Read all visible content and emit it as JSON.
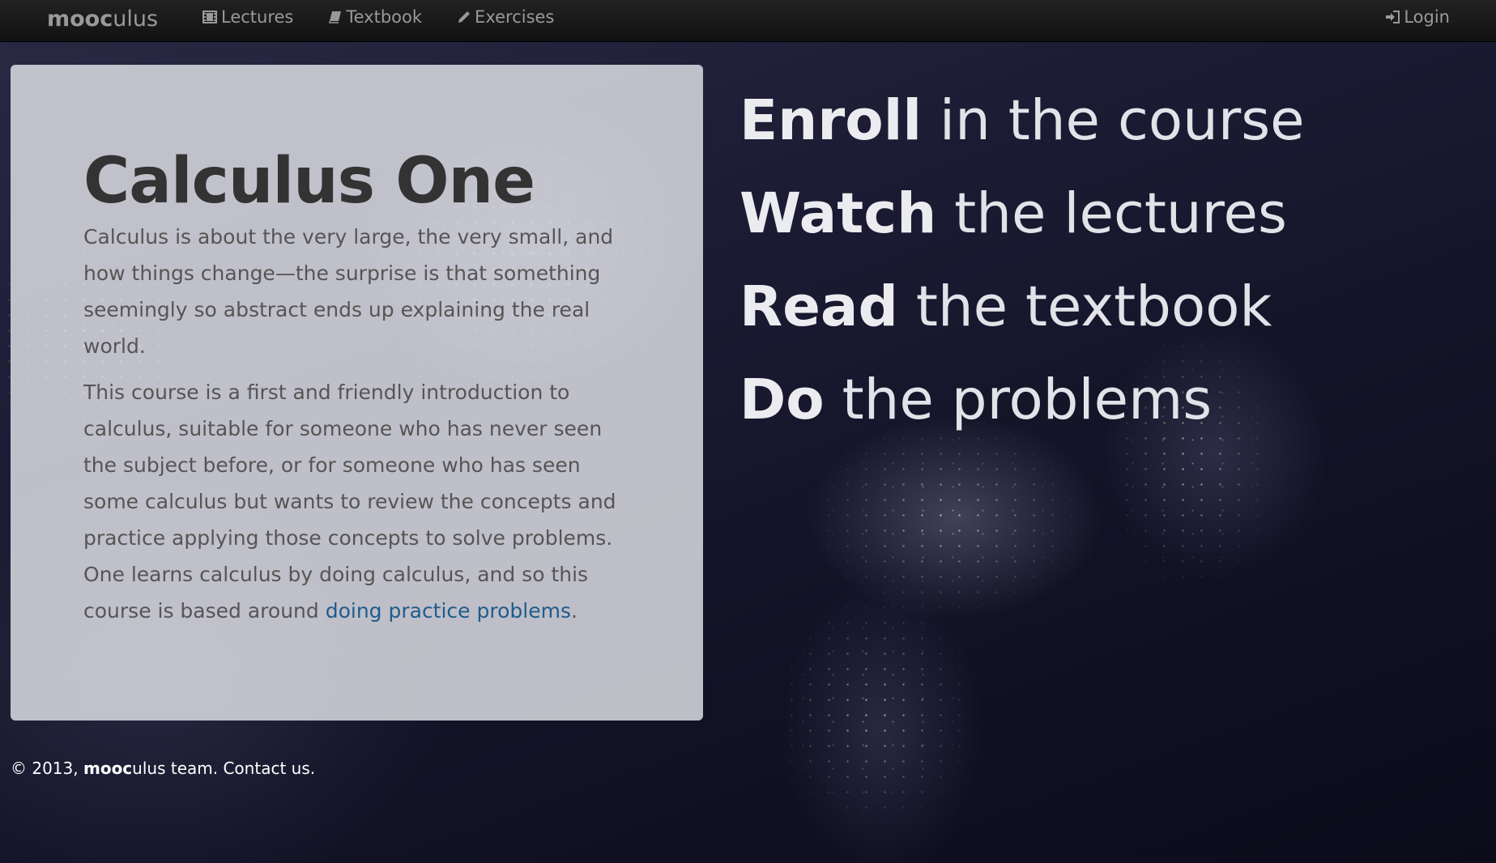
{
  "brand": {
    "bold": "mooc",
    "light": "ulus"
  },
  "nav": {
    "items": [
      {
        "label": "Lectures",
        "icon": "film-icon"
      },
      {
        "label": "Textbook",
        "icon": "book-icon"
      },
      {
        "label": "Exercises",
        "icon": "pencil-icon"
      }
    ],
    "login": {
      "label": "Login",
      "icon": "sign-in-icon"
    }
  },
  "hero": {
    "title": "Calculus One",
    "paragraph1": "Calculus is about the very large, the very small, and how things change—the surprise is that something seemingly so abstract ends up explaining the real world.",
    "paragraph2_text": "This course is a first and friendly introduction to calculus, suitable for someone who has never seen the subject before, or for someone who has seen some calculus but wants to review the concepts and practice applying those concepts to solve problems. One learns calculus by doing calculus, and so this course is based around ",
    "paragraph2_link": "doing practice problems",
    "paragraph2_end": "."
  },
  "steps": [
    {
      "verb": "Enroll",
      "rest": " in the course"
    },
    {
      "verb": "Watch",
      "rest": " the lectures"
    },
    {
      "verb": "Read",
      "rest": " the textbook"
    },
    {
      "verb": "Do",
      "rest": " the problems"
    }
  ],
  "footer": {
    "copyright": "© 2013,",
    "brand_bold": "mooc",
    "brand_light": "ulus",
    "team": " team.",
    "contact": "Contact us."
  },
  "colors": {
    "navbar": "#1b1b1b",
    "nav_text": "#999999",
    "link": "#1f5c8b",
    "hero_title": "#333333"
  }
}
